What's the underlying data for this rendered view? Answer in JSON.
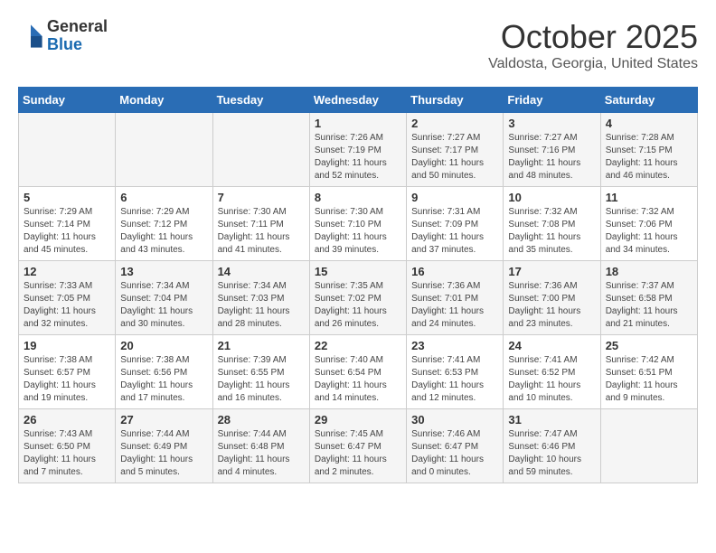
{
  "logo": {
    "general": "General",
    "blue": "Blue"
  },
  "title": "October 2025",
  "location": "Valdosta, Georgia, United States",
  "headers": [
    "Sunday",
    "Monday",
    "Tuesday",
    "Wednesday",
    "Thursday",
    "Friday",
    "Saturday"
  ],
  "rows": [
    [
      {
        "day": "",
        "info": ""
      },
      {
        "day": "",
        "info": ""
      },
      {
        "day": "",
        "info": ""
      },
      {
        "day": "1",
        "info": "Sunrise: 7:26 AM\nSunset: 7:19 PM\nDaylight: 11 hours\nand 52 minutes."
      },
      {
        "day": "2",
        "info": "Sunrise: 7:27 AM\nSunset: 7:17 PM\nDaylight: 11 hours\nand 50 minutes."
      },
      {
        "day": "3",
        "info": "Sunrise: 7:27 AM\nSunset: 7:16 PM\nDaylight: 11 hours\nand 48 minutes."
      },
      {
        "day": "4",
        "info": "Sunrise: 7:28 AM\nSunset: 7:15 PM\nDaylight: 11 hours\nand 46 minutes."
      }
    ],
    [
      {
        "day": "5",
        "info": "Sunrise: 7:29 AM\nSunset: 7:14 PM\nDaylight: 11 hours\nand 45 minutes."
      },
      {
        "day": "6",
        "info": "Sunrise: 7:29 AM\nSunset: 7:12 PM\nDaylight: 11 hours\nand 43 minutes."
      },
      {
        "day": "7",
        "info": "Sunrise: 7:30 AM\nSunset: 7:11 PM\nDaylight: 11 hours\nand 41 minutes."
      },
      {
        "day": "8",
        "info": "Sunrise: 7:30 AM\nSunset: 7:10 PM\nDaylight: 11 hours\nand 39 minutes."
      },
      {
        "day": "9",
        "info": "Sunrise: 7:31 AM\nSunset: 7:09 PM\nDaylight: 11 hours\nand 37 minutes."
      },
      {
        "day": "10",
        "info": "Sunrise: 7:32 AM\nSunset: 7:08 PM\nDaylight: 11 hours\nand 35 minutes."
      },
      {
        "day": "11",
        "info": "Sunrise: 7:32 AM\nSunset: 7:06 PM\nDaylight: 11 hours\nand 34 minutes."
      }
    ],
    [
      {
        "day": "12",
        "info": "Sunrise: 7:33 AM\nSunset: 7:05 PM\nDaylight: 11 hours\nand 32 minutes."
      },
      {
        "day": "13",
        "info": "Sunrise: 7:34 AM\nSunset: 7:04 PM\nDaylight: 11 hours\nand 30 minutes."
      },
      {
        "day": "14",
        "info": "Sunrise: 7:34 AM\nSunset: 7:03 PM\nDaylight: 11 hours\nand 28 minutes."
      },
      {
        "day": "15",
        "info": "Sunrise: 7:35 AM\nSunset: 7:02 PM\nDaylight: 11 hours\nand 26 minutes."
      },
      {
        "day": "16",
        "info": "Sunrise: 7:36 AM\nSunset: 7:01 PM\nDaylight: 11 hours\nand 24 minutes."
      },
      {
        "day": "17",
        "info": "Sunrise: 7:36 AM\nSunset: 7:00 PM\nDaylight: 11 hours\nand 23 minutes."
      },
      {
        "day": "18",
        "info": "Sunrise: 7:37 AM\nSunset: 6:58 PM\nDaylight: 11 hours\nand 21 minutes."
      }
    ],
    [
      {
        "day": "19",
        "info": "Sunrise: 7:38 AM\nSunset: 6:57 PM\nDaylight: 11 hours\nand 19 minutes."
      },
      {
        "day": "20",
        "info": "Sunrise: 7:38 AM\nSunset: 6:56 PM\nDaylight: 11 hours\nand 17 minutes."
      },
      {
        "day": "21",
        "info": "Sunrise: 7:39 AM\nSunset: 6:55 PM\nDaylight: 11 hours\nand 16 minutes."
      },
      {
        "day": "22",
        "info": "Sunrise: 7:40 AM\nSunset: 6:54 PM\nDaylight: 11 hours\nand 14 minutes."
      },
      {
        "day": "23",
        "info": "Sunrise: 7:41 AM\nSunset: 6:53 PM\nDaylight: 11 hours\nand 12 minutes."
      },
      {
        "day": "24",
        "info": "Sunrise: 7:41 AM\nSunset: 6:52 PM\nDaylight: 11 hours\nand 10 minutes."
      },
      {
        "day": "25",
        "info": "Sunrise: 7:42 AM\nSunset: 6:51 PM\nDaylight: 11 hours\nand 9 minutes."
      }
    ],
    [
      {
        "day": "26",
        "info": "Sunrise: 7:43 AM\nSunset: 6:50 PM\nDaylight: 11 hours\nand 7 minutes."
      },
      {
        "day": "27",
        "info": "Sunrise: 7:44 AM\nSunset: 6:49 PM\nDaylight: 11 hours\nand 5 minutes."
      },
      {
        "day": "28",
        "info": "Sunrise: 7:44 AM\nSunset: 6:48 PM\nDaylight: 11 hours\nand 4 minutes."
      },
      {
        "day": "29",
        "info": "Sunrise: 7:45 AM\nSunset: 6:47 PM\nDaylight: 11 hours\nand 2 minutes."
      },
      {
        "day": "30",
        "info": "Sunrise: 7:46 AM\nSunset: 6:47 PM\nDaylight: 11 hours\nand 0 minutes."
      },
      {
        "day": "31",
        "info": "Sunrise: 7:47 AM\nSunset: 6:46 PM\nDaylight: 10 hours\nand 59 minutes."
      },
      {
        "day": "",
        "info": ""
      }
    ]
  ]
}
